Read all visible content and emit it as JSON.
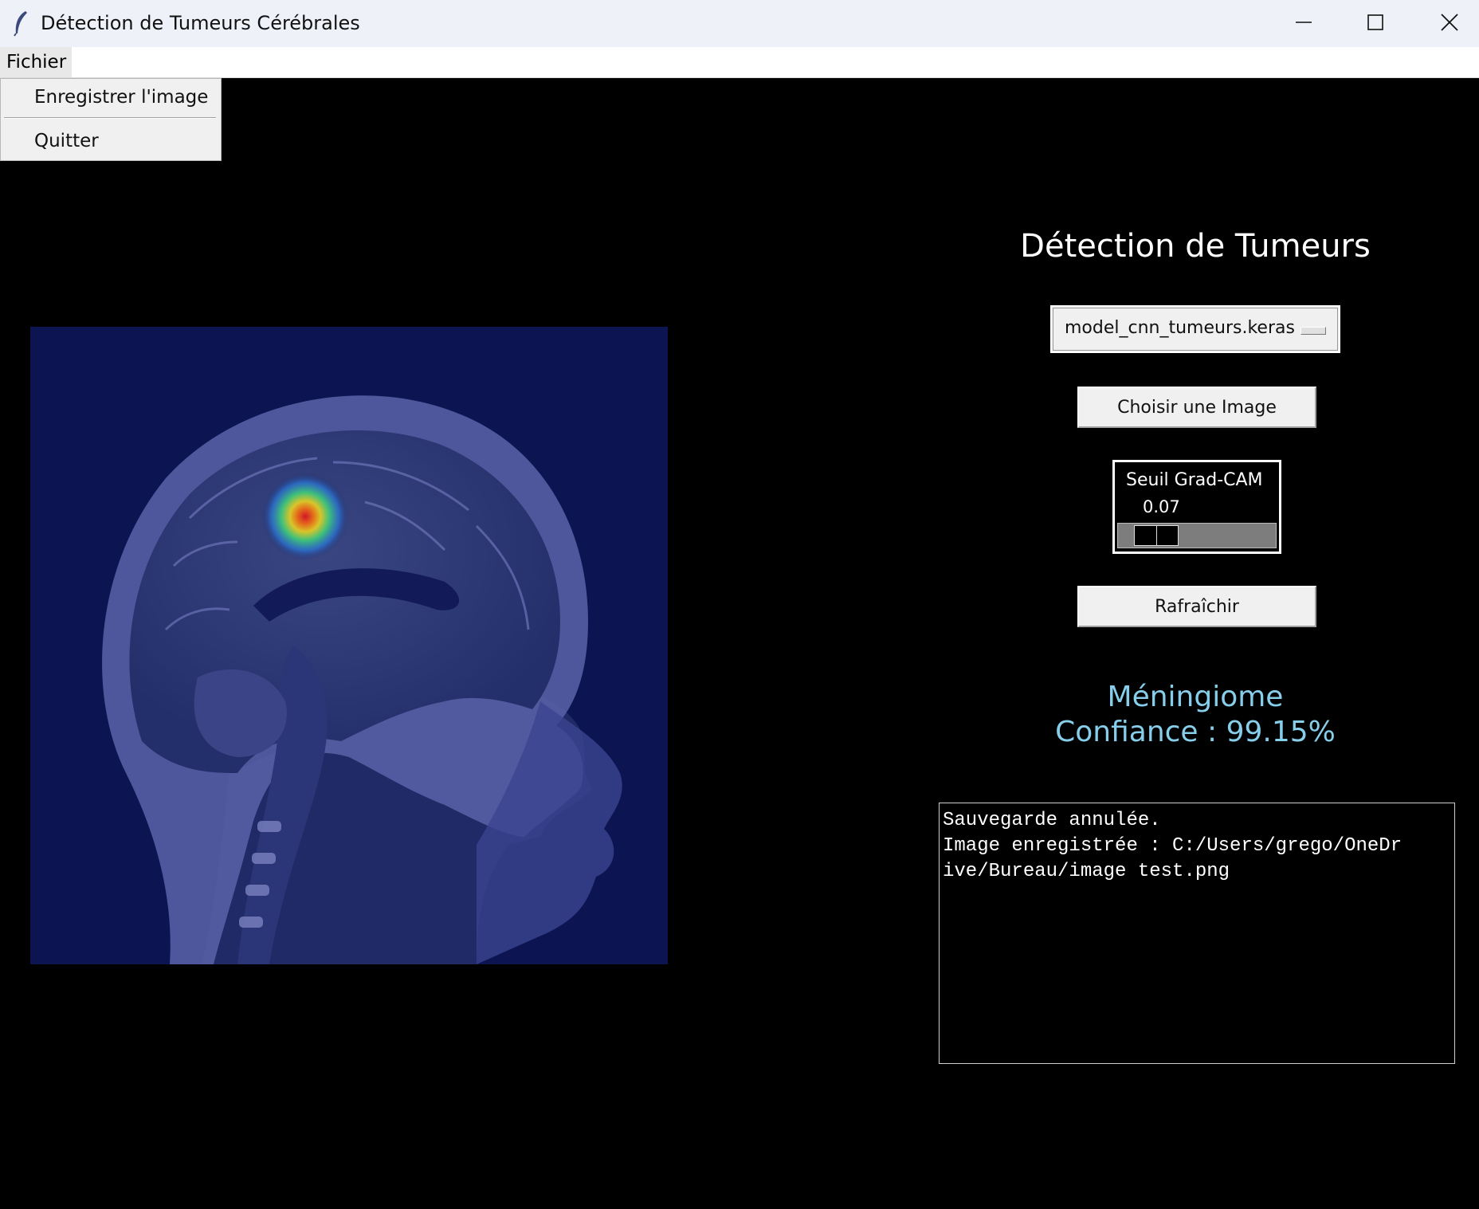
{
  "window": {
    "title": "Détection de Tumeurs Cérébrales",
    "icon": "feather-icon",
    "controls": [
      "minimize-icon",
      "maximize-icon",
      "close-icon"
    ]
  },
  "menubar": {
    "fichier_label": "Fichier"
  },
  "file_menu": {
    "items": [
      {
        "label": "Enregistrer l'image"
      },
      {
        "label": "Quitter"
      }
    ]
  },
  "panel": {
    "title": "Détection de Tumeurs",
    "model_selected": "model_cnn_tumeurs.keras",
    "choose_image_label": "Choisir une Image",
    "threshold": {
      "label": "Seuil Grad-CAM",
      "value": "0.07"
    },
    "refresh_label": "Rafraîchir",
    "result": {
      "prediction": "Méningiome",
      "confidence": "Confiance : 99.15%"
    },
    "log": [
      "Sauvegarde annulée.",
      "Image enregistrée : C:/Users/grego/OneDr",
      "ive/Bureau/image test.png"
    ]
  },
  "colors": {
    "background": "#000000",
    "result_text": "#87ceeb",
    "mri_overlay": "#1b2a66"
  }
}
